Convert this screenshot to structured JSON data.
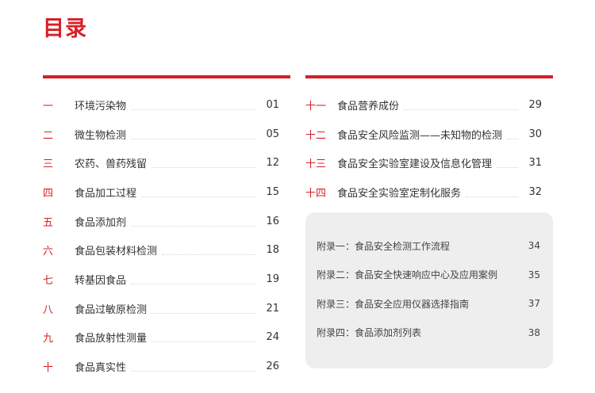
{
  "title": "目录",
  "left_entries": [
    {
      "num": "一",
      "label": "环境污染物",
      "page": "01"
    },
    {
      "num": "二",
      "label": "微生物检测",
      "page": "05"
    },
    {
      "num": "三",
      "label": "农药、兽药残留",
      "page": "12"
    },
    {
      "num": "四",
      "label": "食品加工过程",
      "page": "15"
    },
    {
      "num": "五",
      "label": "食品添加剂",
      "page": "16"
    },
    {
      "num": "六",
      "label": "食品包装材料检测",
      "page": "18"
    },
    {
      "num": "七",
      "label": "转基因食品",
      "page": "19"
    },
    {
      "num": "八",
      "label": "食品过敏原检测",
      "page": "21"
    },
    {
      "num": "九",
      "label": "食品放射性测量",
      "page": "24"
    },
    {
      "num": "十",
      "label": "食品真实性",
      "page": "26"
    }
  ],
  "right_entries": [
    {
      "num": "十一",
      "label": "食品营养成份",
      "page": "29"
    },
    {
      "num": "十二",
      "label": "食品安全风险监测——未知物的检测",
      "page": "30"
    },
    {
      "num": "十三",
      "label": "食品安全实验室建设及信息化管理",
      "page": "31"
    },
    {
      "num": "十四",
      "label": "食品安全实验室定制化服务",
      "page": "32"
    }
  ],
  "appendix_entries": [
    {
      "label": "附录一：食品安全检测工作流程",
      "page": "34"
    },
    {
      "label": "附录二：食品安全快速响应中心及应用案例",
      "page": "35"
    },
    {
      "label": "附录三：食品安全应用仪器选择指南",
      "page": "37"
    },
    {
      "label": "附录四：食品添加剂列表",
      "page": "38"
    }
  ],
  "colors": {
    "accent": "#d71f26",
    "panel": "#eeeeee"
  }
}
